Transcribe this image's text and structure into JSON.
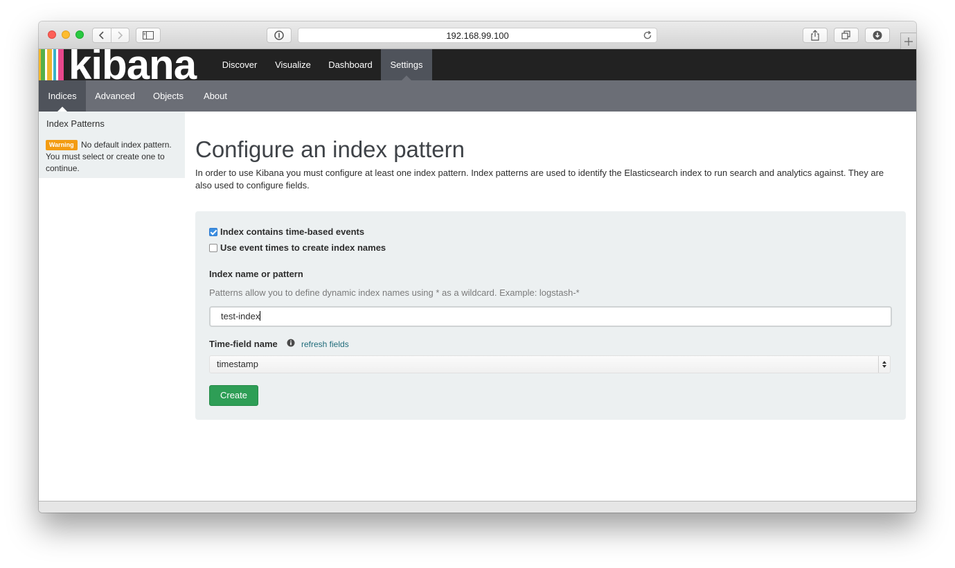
{
  "browser": {
    "address": "192.168.99.100"
  },
  "logo": {
    "text": "kibana",
    "bar_colors": [
      "#e8478b",
      "#f0b62d",
      "#55b04a",
      "#3ab1c8",
      "#e8478b"
    ]
  },
  "topnav": {
    "tabs": [
      {
        "label": "Discover",
        "active": false
      },
      {
        "label": "Visualize",
        "active": false
      },
      {
        "label": "Dashboard",
        "active": false
      },
      {
        "label": "Settings",
        "active": true
      }
    ]
  },
  "subnav": {
    "tabs": [
      {
        "label": "Indices",
        "active": true
      },
      {
        "label": "Advanced",
        "active": false
      },
      {
        "label": "Objects",
        "active": false
      },
      {
        "label": "About",
        "active": false
      }
    ]
  },
  "sidebar": {
    "title": "Index Patterns",
    "warning_badge": "Warning",
    "warning_text": "No default index pattern. You must select or create one to continue."
  },
  "main": {
    "heading": "Configure an index pattern",
    "intro": "In order to use Kibana you must configure at least one index pattern. Index patterns are used to identify the Elasticsearch index to run search and analytics against. They are also used to configure fields."
  },
  "form": {
    "time_based_label": "Index contains time-based events",
    "time_based_checked": true,
    "event_times_label": "Use event times to create index names",
    "event_times_checked": false,
    "index_name_label": "Index name or pattern",
    "index_name_help": "Patterns allow you to define dynamic index names using * as a wildcard. Example: logstash-*",
    "index_name_value": "test-index",
    "time_field_label": "Time-field name",
    "refresh_fields_link": "refresh fields",
    "time_field_value": "timestamp",
    "create_button": "Create"
  },
  "colors": {
    "topnav_bg": "#222222",
    "subnav_bg": "#6b6e76",
    "active_tab": "#4f535b",
    "panel_bg": "#ecf0f1",
    "warning": "#f39c12",
    "create_button": "#2e9e56",
    "checkbox_checked": "#3d8fe1"
  }
}
